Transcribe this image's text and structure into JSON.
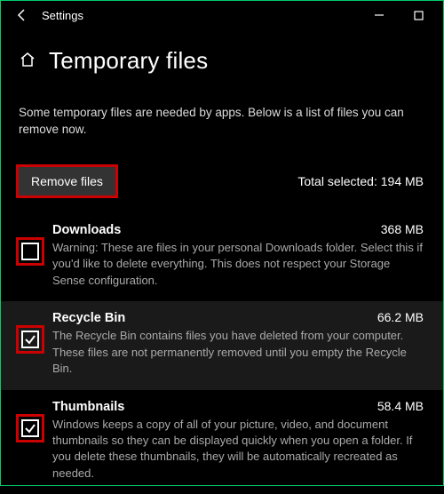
{
  "titlebar": {
    "title": "Settings"
  },
  "header": {
    "title": "Temporary files"
  },
  "intro": "Some temporary files are needed by apps. Below is a list of files you can remove now.",
  "action": {
    "remove_label": "Remove files",
    "total_label": "Total selected: 194 MB"
  },
  "items": [
    {
      "title": "Downloads",
      "size": "368 MB",
      "desc": "Warning: These are files in your personal Downloads folder. Select this if you'd like to delete everything. This does not respect your Storage Sense configuration.",
      "checked": false
    },
    {
      "title": "Recycle Bin",
      "size": "66.2 MB",
      "desc": "The Recycle Bin contains files you have deleted from your computer. These files are not permanently removed until you empty the Recycle Bin.",
      "checked": true
    },
    {
      "title": "Thumbnails",
      "size": "58.4 MB",
      "desc": "Windows keeps a copy of all of your picture, video, and document thumbnails so they can be displayed quickly when you open a folder. If you delete these thumbnails, they will be automatically recreated as needed.",
      "checked": true
    }
  ]
}
